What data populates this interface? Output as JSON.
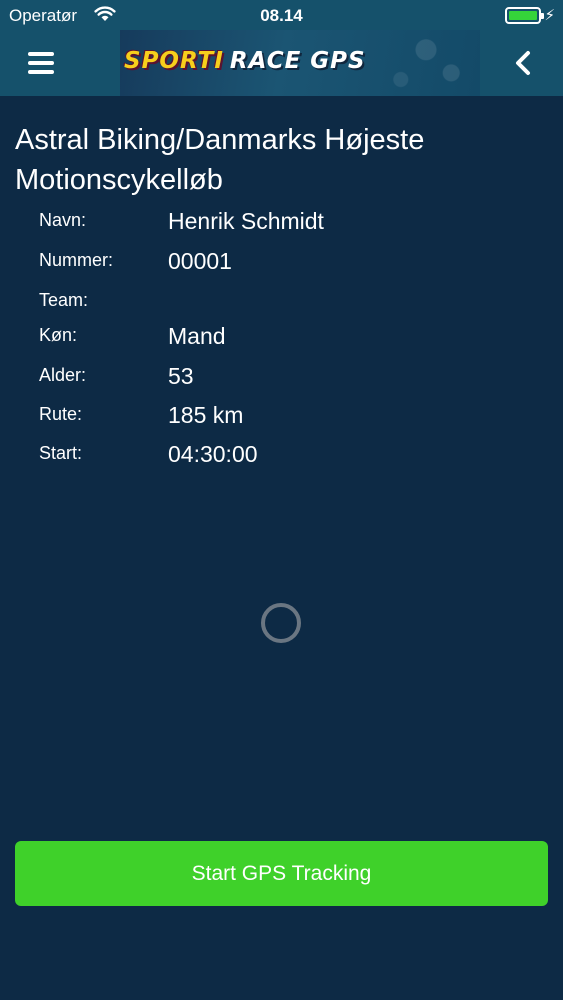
{
  "status_bar": {
    "carrier": "Operatør",
    "time": "08.14",
    "battery_color": "#35d43a"
  },
  "header": {
    "logo_primary": "SPORTI",
    "logo_secondary": "RACE GPS",
    "menu_icon": "hamburger-menu-icon",
    "back_icon": "chevron-left-icon"
  },
  "event": {
    "title": "Astral Biking/Danmarks Højeste Motionscykelløb"
  },
  "participant": [
    {
      "label": "Navn:",
      "value": "Henrik Schmidt"
    },
    {
      "label": "Nummer:",
      "value": "00001"
    },
    {
      "label": "Team:",
      "value": ""
    },
    {
      "label": "Køn:",
      "value": "Mand"
    },
    {
      "label": "Alder:",
      "value": "53"
    },
    {
      "label": "Rute:",
      "value": "185 km"
    },
    {
      "label": "Start:",
      "value": "04:30:00"
    }
  ],
  "actions": {
    "start_tracking_label": "Start GPS Tracking",
    "accent_color": "#3fd12a"
  },
  "theme": {
    "background": "#0d2a45",
    "header_background": "#15516b",
    "logo_yellow": "#f7cf1c"
  }
}
